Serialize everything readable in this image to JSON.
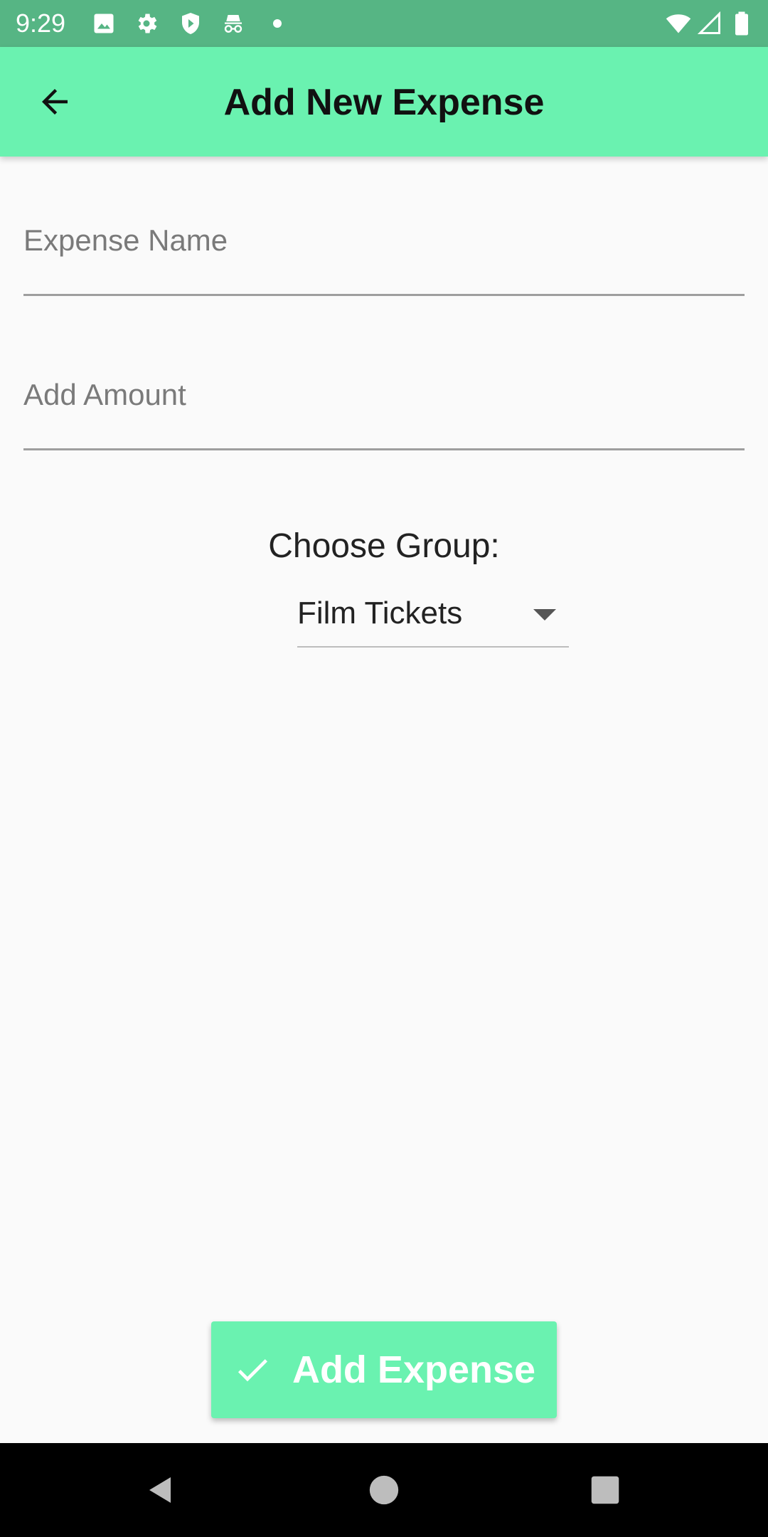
{
  "status_bar": {
    "time": "9:29",
    "icons": [
      "image-icon",
      "gear-icon",
      "shield-icon",
      "incognito-icon",
      "wifi-icon",
      "signal-icon",
      "battery-icon"
    ]
  },
  "app_bar": {
    "title": "Add New Expense",
    "back_icon": "arrow-left-icon"
  },
  "form": {
    "expense_name": {
      "value": "",
      "placeholder": "Expense Name"
    },
    "amount": {
      "value": "",
      "placeholder": "Add Amount"
    },
    "group_label": "Choose Group:",
    "group_selected": "Film Tickets"
  },
  "actions": {
    "add_label": "Add Expense",
    "add_icon": "check-icon"
  },
  "nav_bar": {
    "buttons": [
      "back-triangle-icon",
      "home-circle-icon",
      "recents-square-icon"
    ]
  },
  "colors": {
    "status_bar": "#56b584",
    "accent": "#6af2b0",
    "background": "#fafafa",
    "nav_bar": "#000000"
  }
}
